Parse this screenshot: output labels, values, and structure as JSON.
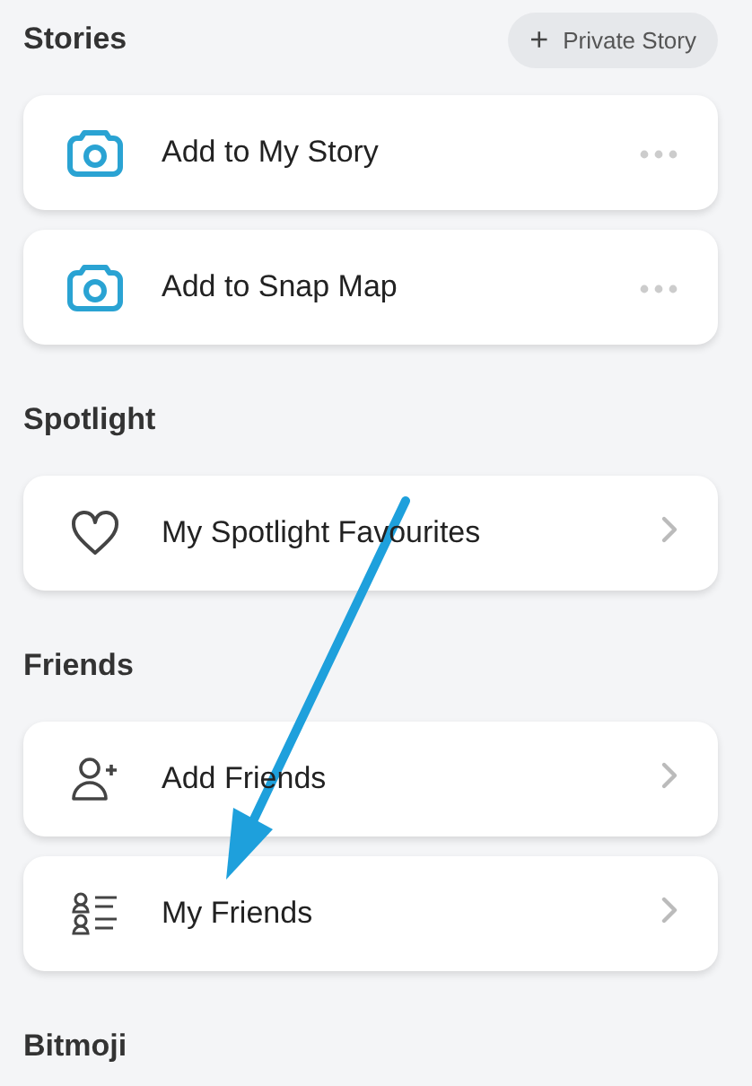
{
  "sections": [
    {
      "title": "Stories",
      "action": {
        "icon": "+",
        "label": "Private Story"
      },
      "items": [
        {
          "label": "Add to My Story"
        },
        {
          "label": "Add to Snap Map"
        }
      ]
    },
    {
      "title": "Spotlight",
      "items": [
        {
          "label": "My Spotlight Favourites"
        }
      ]
    },
    {
      "title": "Friends",
      "items": [
        {
          "label": "Add Friends"
        },
        {
          "label": "My Friends"
        }
      ]
    },
    {
      "title": "Bitmoji"
    }
  ],
  "annotation": {
    "kind": "arrow"
  }
}
